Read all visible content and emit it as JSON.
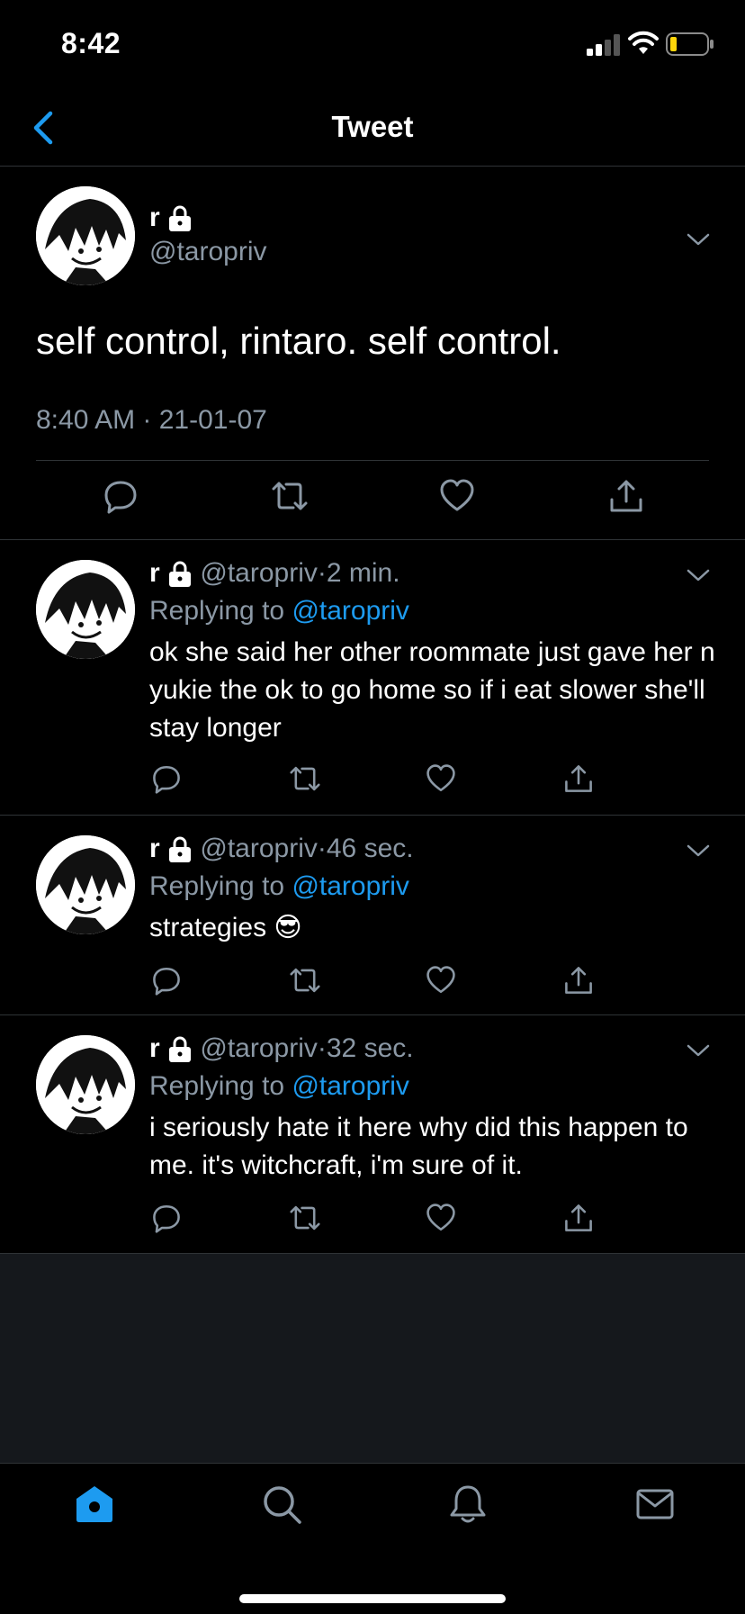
{
  "status_bar": {
    "time": "8:42"
  },
  "header": {
    "title": "Tweet"
  },
  "main_tweet": {
    "name": "r",
    "handle": "@taropriv",
    "text": "self control, rintaro. self control.",
    "timestamp": "8:40 AM · 21-01-07"
  },
  "replies": [
    {
      "name": "r",
      "handle": "@taropriv",
      "separator": "·",
      "time": "2 min.",
      "replying_prefix": "Replying to",
      "replying_to": "@taropriv",
      "text": "ok she said her other roommate just gave her n yukie the ok to go home so if i eat slower she'll stay longer"
    },
    {
      "name": "r",
      "handle": "@taropriv",
      "separator": "·",
      "time": "46 sec.",
      "replying_prefix": "Replying to",
      "replying_to": "@taropriv",
      "text": "strategies 😎"
    },
    {
      "name": "r",
      "handle": "@taropriv",
      "separator": "·",
      "time": "32 sec.",
      "replying_prefix": "Replying to",
      "replying_to": "@taropriv",
      "text": "i seriously hate it here why did this happen to me. it's witchcraft, i'm sure of it."
    }
  ],
  "icons": {
    "actions": [
      "reply-icon",
      "retweet-icon",
      "like-icon",
      "share-icon"
    ],
    "tabs": [
      "home-icon",
      "search-icon",
      "notifications-icon",
      "messages-icon"
    ]
  },
  "colors": {
    "background": "#000000",
    "accent": "#1d9bf0",
    "secondary_text": "#8b98a5",
    "divider": "#2f3336",
    "empty_area": "#15181c"
  }
}
